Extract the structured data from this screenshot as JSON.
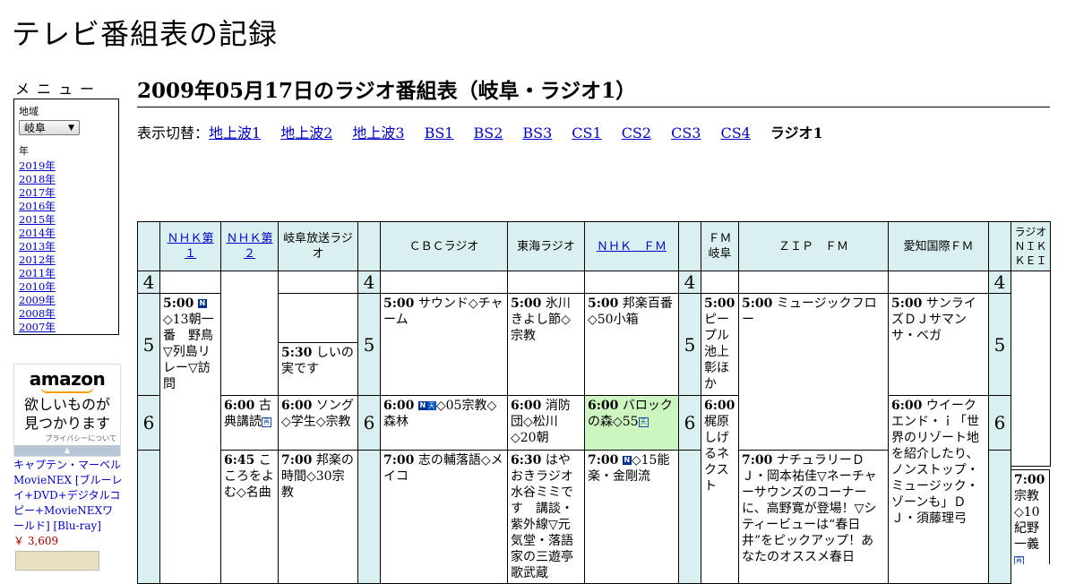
{
  "site_title": "テレビ番組表の記録",
  "menu": {
    "label": "メニュー",
    "region_caption": "地域",
    "region_value": "岐阜",
    "year_caption": "年",
    "years": [
      "2019年",
      "2018年",
      "2017年",
      "2016年",
      "2015年",
      "2014年",
      "2013年",
      "2012年",
      "2011年",
      "2010年",
      "2009年",
      "2008年",
      "2007年"
    ]
  },
  "ad": {
    "logo": "amazon",
    "catch_line1": "欲しいものが",
    "catch_line2": "見つかります",
    "privacy": "プライバシーについて",
    "product_title": "キャプテン・マーベル MovieNEX [ブルーレイ+DVD+デジタルコピー+MovieNEXワールド] [Blu-ray]",
    "product_price": "￥ 3,609"
  },
  "page_heading": "2009年05月17日のラジオ番組表（岐阜・ラジオ1）",
  "switcher": {
    "label": "表示切替：",
    "links": [
      "地上波1",
      "地上波2",
      "地上波3",
      "BS1",
      "BS2",
      "BS3",
      "CS1",
      "CS2",
      "CS3",
      "CS4"
    ],
    "current": "ラジオ1"
  },
  "stations": [
    "ＮＨＫ第１",
    "ＮＨＫ第２",
    "岐阜放送ラジオ",
    "ＣＢＣラジオ",
    "東海ラジオ",
    "ＮＨＫ　ＦＭ",
    "ＦＭ岐阜",
    "ＺＩＰ　ＦＭ",
    "愛知国際ＦＭ",
    "ラジオＮＩＫＫＥＩ"
  ],
  "hours": [
    "4",
    "5",
    "6"
  ],
  "programs": {
    "nhk1_500_time": "5:00",
    "nhk1_500_text": "◇13朝一番　野鳥▽列島リレー▽訪問",
    "gifu_530_time": "5:30",
    "gifu_530_text": "しいの実です",
    "nhk2_600_time": "6:00",
    "nhk2_600_text": "古典講読",
    "nhk2_645_time": "6:45",
    "nhk2_645_text": "こころをよむ◇名曲",
    "gifu_600_time": "6:00",
    "gifu_600_text": "ソング◇学生◇宗教",
    "gifu_700_time": "7:00",
    "gifu_700_text": "邦楽の時間◇30宗教",
    "cbc_500_time": "5:00",
    "cbc_500_text": "サウンド◇チャーム",
    "cbc_600_time": "6:00",
    "cbc_600_text": "◇05宗教◇森林",
    "cbc_700_time": "7:00",
    "cbc_700_text": "志の輔落語◇メイコ",
    "tokai_500_time": "5:00",
    "tokai_500_text": "氷川きよし節◇宗教",
    "tokai_600_time": "6:00",
    "tokai_600_text": "消防団◇松川◇20朝",
    "tokai_630_time": "6:30",
    "tokai_630_text": "はやおきラジオ水谷ミミです　講談・紫外線▽元気堂・落語家の三遊亭歌武蔵",
    "nhkfm_500_time": "5:00",
    "nhkfm_500_text": "邦楽百番◇50小箱",
    "nhkfm_600_time": "6:00",
    "nhkfm_600_text": "バロックの森◇55",
    "nhkfm_700_time": "7:00",
    "nhkfm_700_text": "◇15能楽・金剛流",
    "fmgifu_500_time": "5:00",
    "fmgifu_500_text": "ピープル池上彰ほか",
    "fmgifu_600_time": "6:00",
    "fmgifu_600_text": "梶原しげるネクスト",
    "zip_500_time": "5:00",
    "zip_500_text": "ミュージックフロー",
    "zip_700_time": "7:00",
    "zip_700_text": "ナチュラリーＤＪ・岡本祐佳▽ネーチャーサウンズのコーナーに、高野寛が登場！▽シティービューは“春日井”をピックアップ！あなたのオススメ春日",
    "aichi_500_time": "5:00",
    "aichi_500_text": "サンライズＤＪサマンサ・ベガ",
    "aichi_600_time": "6:00",
    "aichi_600_text": "ウイークエンド・ｉ「世界のリゾート地を紹介したり、ノンストップ・ミュージック・ゾーンも」ＤＪ・須藤理弓",
    "nikkei_700_time": "7:00",
    "nikkei_700_text": "宗教◇10紀野一義"
  },
  "icons": {
    "news": "N",
    "weather": "天",
    "rebroadcast": "再"
  }
}
